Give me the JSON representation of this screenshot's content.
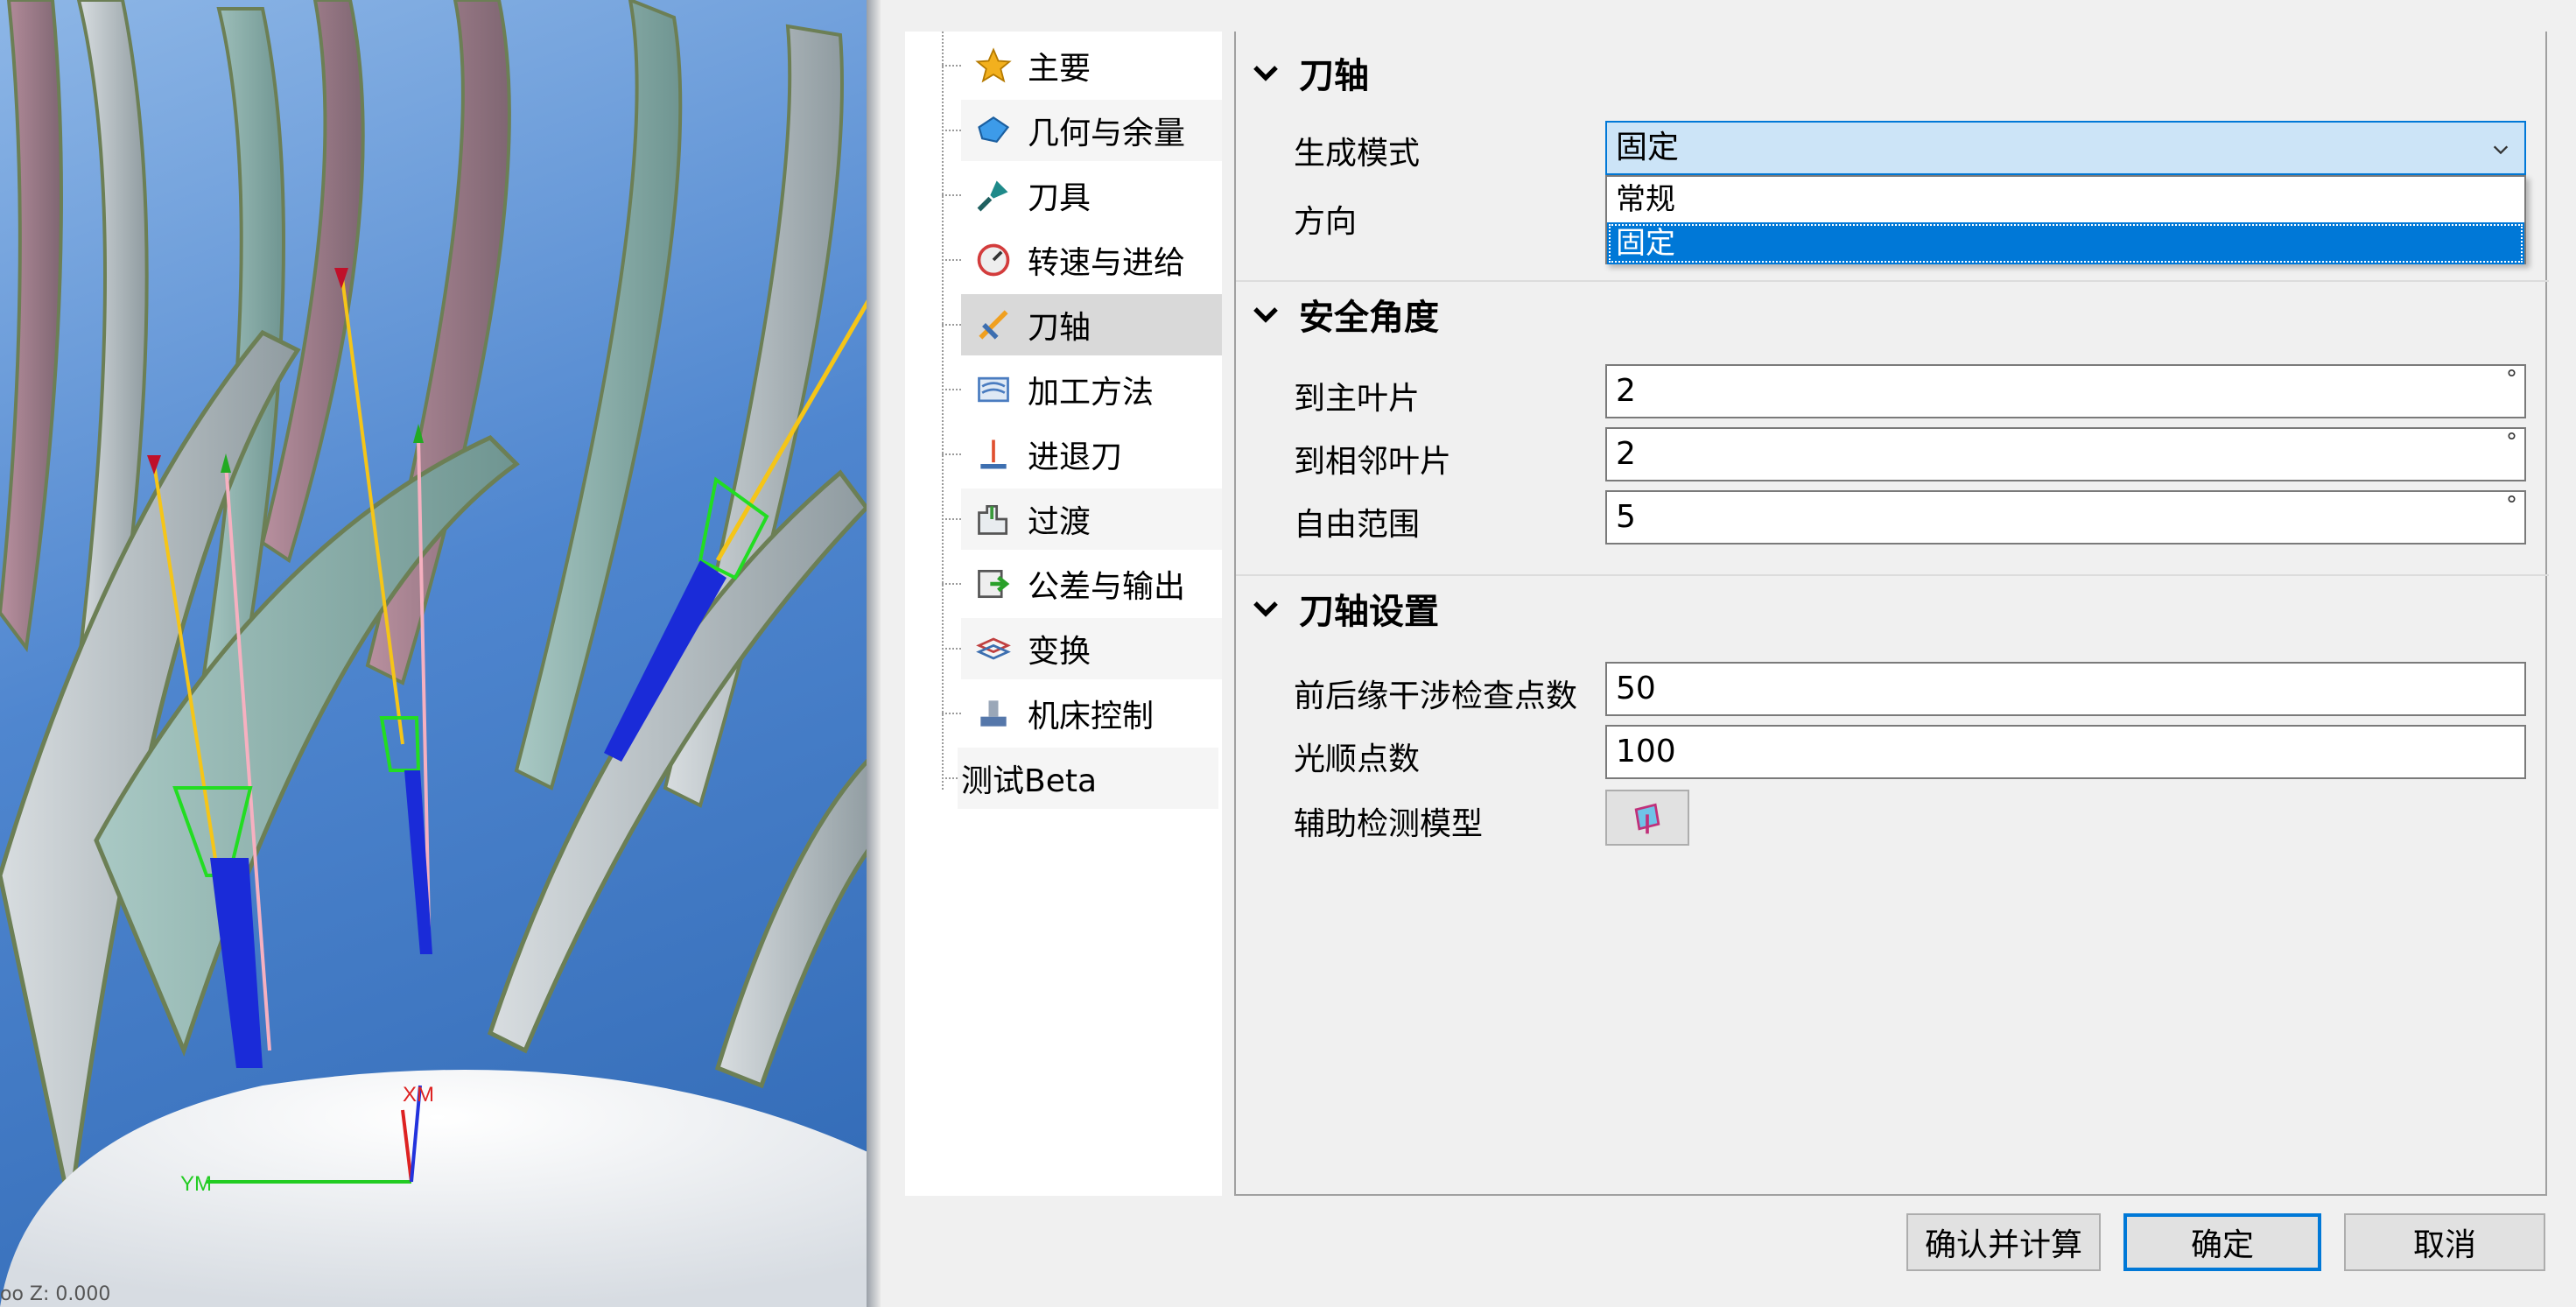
{
  "viewport": {
    "status_text": "oo Z: 0.000",
    "axis_x_label": "XM",
    "axis_y_label": "YM"
  },
  "tree": {
    "items": [
      {
        "label": "主要",
        "icon": "star-icon",
        "color": "#f2b01e"
      },
      {
        "label": "几何与余量",
        "icon": "geometry-icon",
        "color": "#3d9be9"
      },
      {
        "label": "刀具",
        "icon": "cutting-tool-icon",
        "color": "#1f8a8a"
      },
      {
        "label": "转速与进给",
        "icon": "speed-feed-icon",
        "color": "#d33c3c"
      },
      {
        "label": "刀轴",
        "icon": "tool-axis-icon",
        "color": "#f0a020",
        "selected": true
      },
      {
        "label": "加工方法",
        "icon": "machining-method-icon",
        "color": "#4a7cc0"
      },
      {
        "label": "进退刀",
        "icon": "lead-in-out-icon",
        "color": "#e05030"
      },
      {
        "label": "过渡",
        "icon": "transition-icon",
        "color": "#3a9a3a"
      },
      {
        "label": "公差与输出",
        "icon": "tolerance-output-icon",
        "color": "#2aa02a"
      },
      {
        "label": "变换",
        "icon": "transform-icon",
        "color": "#c04040"
      },
      {
        "label": "机床控制",
        "icon": "machine-control-icon",
        "color": "#5577aa"
      },
      {
        "label": "测试Beta",
        "icon": "",
        "color": ""
      }
    ]
  },
  "sections": {
    "tool_axis": {
      "title": "刀轴",
      "mode_label": "生成模式",
      "mode_value": "固定",
      "mode_options": [
        "常规",
        "固定"
      ],
      "direction_label": "方向"
    },
    "safety_angle": {
      "title": "安全角度",
      "main_blade_label": "到主叶片",
      "main_blade_value": "2",
      "adjacent_blade_label": "到相邻叶片",
      "adjacent_blade_value": "2",
      "free_range_label": "自由范围",
      "free_range_value": "5",
      "unit": "°"
    },
    "axis_settings": {
      "title": "刀轴设置",
      "edge_check_label": "前后缘干涉检查点数",
      "edge_check_value": "50",
      "smooth_points_label": "光顺点数",
      "smooth_points_value": "100",
      "aux_model_label": "辅助检测模型"
    }
  },
  "buttons": {
    "confirm_calc": "确认并计算",
    "ok": "确定",
    "cancel": "取消"
  },
  "colors": {
    "accent": "#0078d7",
    "selection_bg": "#cce4f7"
  }
}
